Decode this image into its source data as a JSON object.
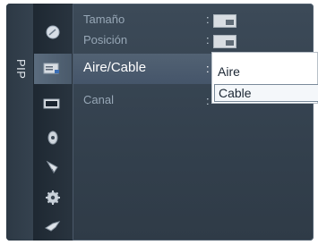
{
  "side_label": "PIP",
  "menu": {
    "items": [
      {
        "label": "Tamaño",
        "has_value_icon": true
      },
      {
        "label": "Posición",
        "has_value_icon": true
      },
      {
        "label": "Aire/Cable",
        "selected": true
      },
      {
        "label": "Canal"
      }
    ],
    "separator": ":"
  },
  "dropdown": {
    "options": [
      "Aire",
      "Cable"
    ],
    "highlighted": "Cable"
  },
  "icons": [
    "picture-icon",
    "sound-icon",
    "channel-icon",
    "setup-icon",
    "input-icon",
    "application-icon",
    "support-icon"
  ],
  "colors": {
    "panel": "#3c4a58",
    "selected_row": "#526273",
    "inactive_text": "#97a7b6",
    "active_text": "#ffffff"
  }
}
